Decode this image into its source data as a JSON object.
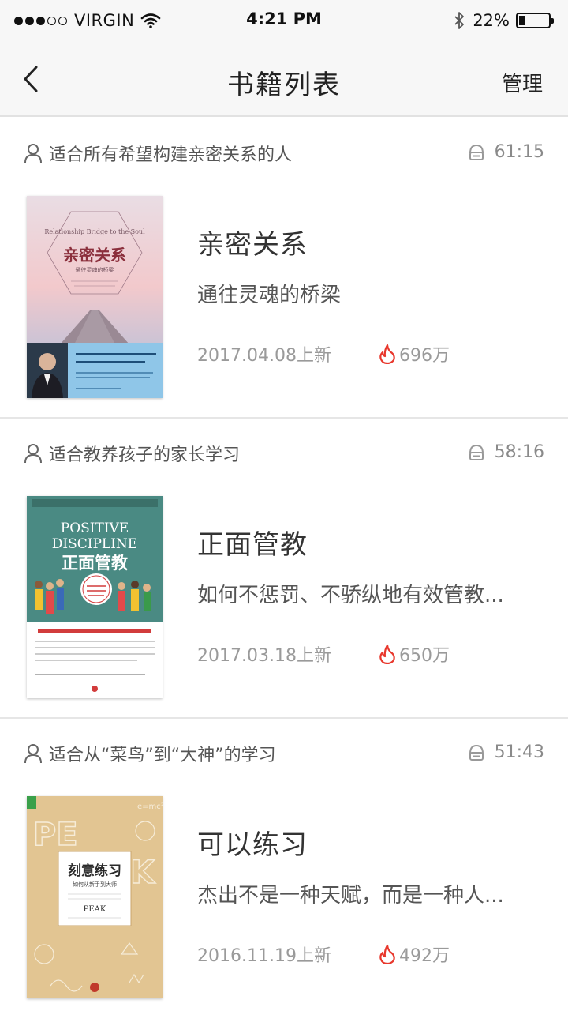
{
  "status_bar": {
    "carrier": "VIRGIN",
    "time": "4:21 PM",
    "battery": "22%",
    "battery_level": 0.22
  },
  "nav": {
    "title": "书籍列表",
    "action": "管理"
  },
  "books": [
    {
      "audience": "适合所有希望构建亲密关系的人",
      "duration": "61:15",
      "title": "亲密关系",
      "subtitle": "通往灵魂的桥梁",
      "date": "2017.04.08上新",
      "plays": "696万",
      "cover": {
        "title": "亲密关系",
        "subtitle": "通往灵魂的桥梁",
        "en": "Relationship Bridge to the Soul"
      }
    },
    {
      "audience": "适合教养孩子的家长学习",
      "duration": "58:16",
      "title": "正面管教",
      "subtitle": "如何不惩罚、不骄纵地有效管教...",
      "date": "2017.03.18上新",
      "plays": "650万",
      "cover": {
        "title": "正面管教",
        "en1": "POSITIVE",
        "en2": "DISCIPLINE"
      }
    },
    {
      "audience": "适合从“菜鸟”到“大神”的学习",
      "duration": "51:43",
      "title": "可以练习",
      "subtitle": "杰出不是一种天赋，而是一种人...",
      "date": "2016.11.19上新",
      "plays": "492万",
      "cover": {
        "title": "刻意练习",
        "subtitle": "如何从新手到大师",
        "en": "PEAK",
        "formula": "e=mc²"
      }
    }
  ],
  "colors": {
    "flame": "#e8372c",
    "bar_bg": "#f7f7f7",
    "divider": "#e6e6e6"
  }
}
